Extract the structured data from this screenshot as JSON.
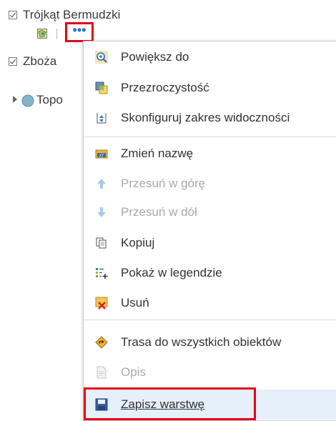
{
  "layers": [
    {
      "label": "Trójkąt Bermudzki",
      "checked": true
    },
    {
      "label": "Zboża",
      "checked": true
    },
    {
      "label": "Topo",
      "checked": false
    }
  ],
  "more_button": {
    "glyph": "•••",
    "icon": "more-options-icon"
  },
  "menu": {
    "items": [
      {
        "label": "Powiększ do",
        "icon": "zoom-in-icon",
        "enabled": true
      },
      {
        "label": "Przezroczystość",
        "icon": "transparency-icon",
        "enabled": true
      },
      {
        "label": "Skonfiguruj zakres widoczności",
        "icon": "visibility-range-icon",
        "enabled": true
      },
      {
        "label": "Zmień nazwę",
        "icon": "rename-icon",
        "enabled": true
      },
      {
        "label": "Przesuń w górę",
        "icon": "arrow-up-icon",
        "enabled": false
      },
      {
        "label": "Przesuń w dół",
        "icon": "arrow-down-icon",
        "enabled": false
      },
      {
        "label": "Kopiuj",
        "icon": "copy-icon",
        "enabled": true
      },
      {
        "label": "Pokaż w legendzie",
        "icon": "show-legend-icon",
        "enabled": true
      },
      {
        "label": "Usuń",
        "icon": "remove-icon",
        "enabled": true
      },
      {
        "label": "Trasa do wszystkich obiektów",
        "icon": "route-icon",
        "enabled": true
      },
      {
        "label": "Opis",
        "icon": "description-icon",
        "enabled": false
      },
      {
        "label": "Zapisz warstwę",
        "icon": "save-icon",
        "enabled": true,
        "highlighted": true
      }
    ]
  },
  "colors": {
    "accent_red": "#e2001a",
    "link_blue": "#2a7ad0",
    "highlight_bg": "#e6f0fa",
    "disabled_text": "#a9a9a9"
  }
}
